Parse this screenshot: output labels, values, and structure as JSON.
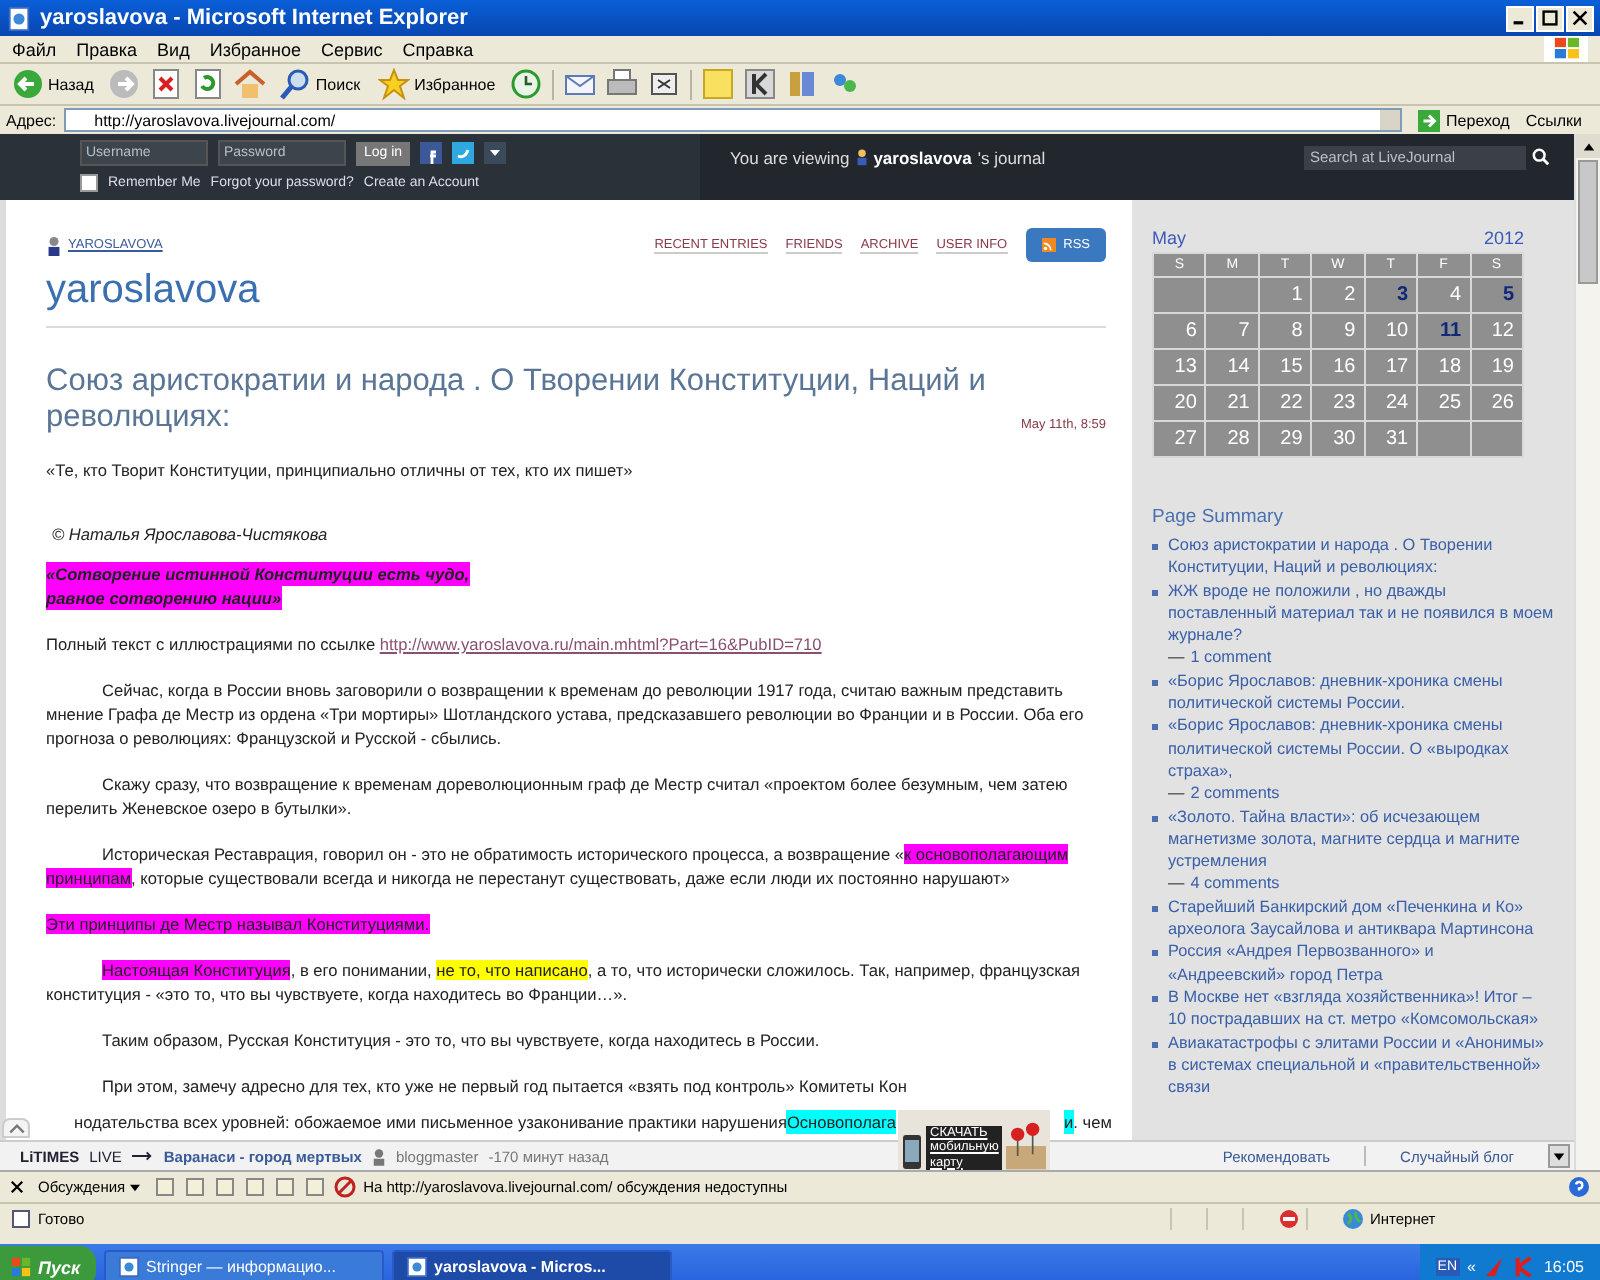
{
  "window": {
    "title": "yaroslavova - Microsoft Internet Explorer"
  },
  "menu": [
    "Файл",
    "Правка",
    "Вид",
    "Избранное",
    "Сервис",
    "Справка"
  ],
  "toolbar": {
    "back": "Назад",
    "search": "Поиск",
    "favorites": "Избранное"
  },
  "address": {
    "label": "Адрес:",
    "url": "http://yaroslavova.livejournal.com/",
    "go": "Переход",
    "links": "Ссылки"
  },
  "lj_bar": {
    "username": {
      "placeholder": "Username"
    },
    "password": {
      "placeholder": "Password"
    },
    "login": "Log in",
    "remember": {
      "label": "Remember Me",
      "checked": false
    },
    "forgot": "Forgot your password?",
    "create": "Create an Account",
    "viewing_prefix": "You are viewing",
    "viewing_user": "yaroslavova",
    "viewing_suffix": "'s journal",
    "search": {
      "placeholder": "Search at LiveJournal"
    }
  },
  "journal": {
    "user_link": "YAROSLAVOVA",
    "nav": [
      "RECENT ENTRIES",
      "FRIENDS",
      "ARCHIVE",
      "USER INFO"
    ],
    "rss": "RSS",
    "title": "yaroslavova"
  },
  "entry": {
    "title": "Союз аристократии и народа . О Творении Конституции, Наций и революциях:",
    "date": "May 11th, 8:59",
    "paragraphs": [
      {
        "kind": "plain",
        "segments": [
          {
            "text": "«Те, кто Творит Конституции, принципиально отличны от тех, кто их пишет»"
          }
        ]
      },
      {
        "kind": "author",
        "segments": [
          {
            "text": "© Наталья Ярославова-Чистякова"
          }
        ]
      },
      {
        "kind": "callout",
        "segments": [
          {
            "text": "«Сотворение истинной Конституции есть чудо,",
            "color": "#ff00ff"
          },
          {
            "text": "равное сотворению нации»",
            "color": "#ff00ff"
          }
        ]
      },
      {
        "kind": "plain",
        "segments": [
          {
            "text": "Полный     текст     с иллюстрациями по ссылке  "
          },
          {
            "text": "http://www.yaroslavova.ru/main.mhtml?Part=16&PubID=710",
            "link": true
          }
        ]
      },
      {
        "kind": "indent",
        "segments": [
          {
            "text": "Сейчас, когда в России вновь заговорили о возвращении к временам до революции 1917 года, считаю важным представить мнение Графа де Местр из ордена «Три мортиры» Шотландского устава, предсказавшего революции во Франции и в России. Оба его прогноза о революциях: Французской и Русской - сбылись."
          }
        ]
      },
      {
        "kind": "indent",
        "segments": [
          {
            "text": "Скажу сразу, что возвращение к временам дореволюционным граф де Местр считал «проектом более безумным, чем затею перелить Женевское озеро в бутылки»."
          }
        ]
      },
      {
        "kind": "indent",
        "segments": [
          {
            "text": "Историческая Реставрация, говорил он - это не обратимость исторического процесса, а возвращение «"
          },
          {
            "text": "к основополагающим принципам",
            "color": "#ff00ff"
          },
          {
            "text": ", которые существовали всегда и никогда не перестанут существовать, даже если люди их постоянно нарушают»"
          }
        ]
      },
      {
        "kind": "plain",
        "segments": [
          {
            "text": "Эти принципы де Местр называл Конституциями.",
            "color": "#ff00ff"
          }
        ]
      },
      {
        "kind": "indent",
        "segments": [
          {
            "text": "Настоящая Конституция",
            "color": "#ff00ff"
          },
          {
            "text": ", в его понимании, "
          },
          {
            "text": "не то, что написано",
            "color": "#ffff00"
          },
          {
            "text": ", а то, что исторически сложилось. Так, например, французская конституция - «это то, что вы чувствуете, когда находитесь во Франции…»."
          }
        ]
      },
      {
        "kind": "indent",
        "segments": [
          {
            "text": "Таким образом, Русская Конституция - это то, что вы чувствуете, когда находитесь в России."
          }
        ]
      },
      {
        "kind": "indent",
        "segments": [
          {
            "text": "При этом, замечу адресно для тех, кто уже не первый год пытается «взять под контроль» Комитеты Кон"
          }
        ]
      }
    ],
    "cut_line": [
      {
        "text": "нодательства всех уровней: обожаемое ими письменное узаконивание практики нарушения "
      },
      {
        "text": "Основополага",
        "color": "#00ffff"
      },
      {
        "text": "и",
        "color": "#00ffff"
      },
      {
        "text": ". чем"
      }
    ]
  },
  "calendar": {
    "month": "May",
    "year": "2012",
    "weekdays": [
      "S",
      "M",
      "T",
      "W",
      "T",
      "F",
      "S"
    ],
    "weeks": [
      {
        "kind": "first",
        "days": [
          {
            "day": "1",
            "linked": false
          },
          {
            "day": "2",
            "linked": false
          },
          {
            "day": "3",
            "linked": true
          },
          {
            "day": "4",
            "linked": false
          },
          {
            "day": "5",
            "linked": true
          }
        ]
      },
      {
        "kind": "full",
        "days": [
          {
            "day": "6",
            "linked": false
          },
          {
            "day": "7",
            "linked": false
          },
          {
            "day": "8",
            "linked": false
          },
          {
            "day": "9",
            "linked": false
          },
          {
            "day": "10",
            "linked": false
          },
          {
            "day": "11",
            "linked": true
          },
          {
            "day": "12",
            "linked": false
          }
        ]
      },
      {
        "kind": "full",
        "days": [
          {
            "day": "13",
            "linked": false
          },
          {
            "day": "14",
            "linked": false
          },
          {
            "day": "15",
            "linked": false
          },
          {
            "day": "16",
            "linked": false
          },
          {
            "day": "17",
            "linked": false
          },
          {
            "day": "18",
            "linked": false
          },
          {
            "day": "19",
            "linked": false
          }
        ]
      },
      {
        "kind": "full",
        "days": [
          {
            "day": "20",
            "linked": false
          },
          {
            "day": "21",
            "linked": false
          },
          {
            "day": "22",
            "linked": false
          },
          {
            "day": "23",
            "linked": false
          },
          {
            "day": "24",
            "linked": false
          },
          {
            "day": "25",
            "linked": false
          },
          {
            "day": "26",
            "linked": false
          }
        ]
      },
      {
        "kind": "last",
        "days": [
          {
            "day": "27",
            "linked": false
          },
          {
            "day": "28",
            "linked": false
          },
          {
            "day": "29",
            "linked": false
          },
          {
            "day": "30",
            "linked": false
          },
          {
            "day": "31",
            "linked": false
          }
        ]
      }
    ]
  },
  "page_summary": {
    "title": "Page Summary",
    "items": [
      {
        "title": "Союз аристократии и народа . О Творении Конституции, Наций и революциях:"
      },
      {
        "title": "ЖЖ вроде не положили , но дважды поставленный материал так и не появился в моем журнале?",
        "separator": "—",
        "comments": "1 comment"
      },
      {
        "title": "«Борис Ярославов: дневник-хроника смены политической системы России."
      },
      {
        "title": "«Борис Ярославов: дневник-хроника смены политической системы России. О «выродках страха»,",
        "separator": "—",
        "comments": "2 comments"
      },
      {
        "title": "«Золото. Тайна власти»: об исчезающем магнетизме золота, магните сердца и магните устремления",
        "separator": "—",
        "comments": "4 comments"
      },
      {
        "title": "Старейший Банкирский дом «Печенкина и Ко» археолога Заусайлова и антиквара Мартинсона"
      },
      {
        "title": "Россия «Андрея Первозванного» и «Андреевский» город Петра"
      },
      {
        "title": "В Москве нет «взгляда хозяйственника»! Итог – 10 пострадавших на ст. метро «Комсомольская»"
      },
      {
        "title": "Авиакатастрофы с элитами России и «Анонимы» в системах специальной и «правительственной» связи"
      }
    ]
  },
  "litimes_bar": {
    "logo": "LiTIMES",
    "live": "LIVE",
    "headline": "Варанаси - город мертвых",
    "user": "bloggmaster",
    "time": "-170 минут назад",
    "recommend": "Рекомендовать",
    "random": "Случайный блог"
  },
  "ad": {
    "lines": [
      "СКАЧАТЬ",
      "мобильную",
      "карту"
    ]
  },
  "discussion_bar": {
    "menu": "Обсуждения",
    "message": "На http://yaroslavova.livejournal.com/ обсуждения недоступны"
  },
  "status_bar": {
    "text": "Готово",
    "zone": "Интернет"
  },
  "taskbar": {
    "start": "Пуск",
    "tasks": [
      {
        "label": "Stringer — информацио...",
        "selected": false
      },
      {
        "label": "yaroslavova - Micros...",
        "selected": true
      }
    ],
    "lang": "EN",
    "chevron": "«",
    "time": "16:05"
  }
}
